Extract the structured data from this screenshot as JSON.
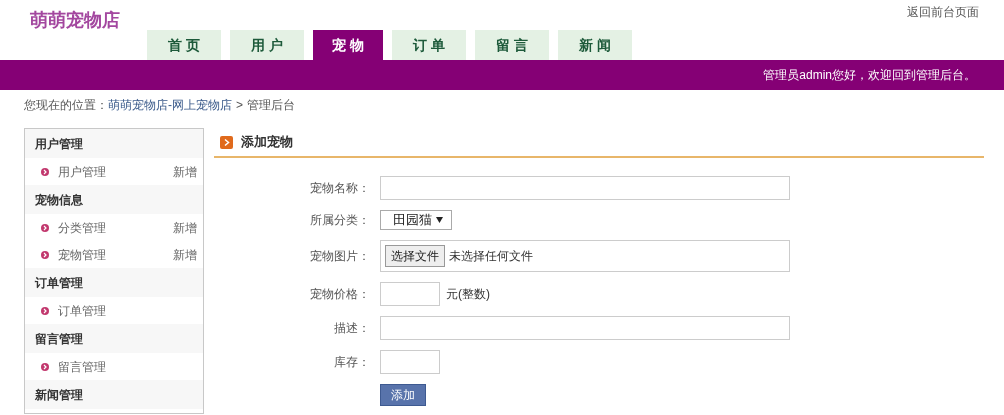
{
  "header": {
    "logo": "萌萌宠物店",
    "front_link": "返回前台页面",
    "welcome": "管理员admin您好，欢迎回到管理后台。"
  },
  "tabs": [
    {
      "label": "首 页",
      "selected": false
    },
    {
      "label": "用 户",
      "selected": false
    },
    {
      "label": "宠 物",
      "selected": true
    },
    {
      "label": "订 单",
      "selected": false
    },
    {
      "label": "留 言",
      "selected": false
    },
    {
      "label": "新 闻",
      "selected": false
    }
  ],
  "breadcrumb": {
    "prefix": "您现在的位置：",
    "link": "萌萌宠物店-网上宠物店",
    "separator": ">",
    "current": "管理后台"
  },
  "sidebar": [
    {
      "title": "用户管理",
      "items": [
        {
          "label": "用户管理",
          "action": "新增"
        }
      ]
    },
    {
      "title": "宠物信息",
      "items": [
        {
          "label": "分类管理",
          "action": "新增"
        },
        {
          "label": "宠物管理",
          "action": "新增"
        }
      ]
    },
    {
      "title": "订单管理",
      "items": [
        {
          "label": "订单管理"
        }
      ]
    },
    {
      "title": "留言管理",
      "items": [
        {
          "label": "留言管理"
        }
      ]
    },
    {
      "title": "新闻管理"
    }
  ],
  "panel": {
    "title": "添加宠物",
    "fields": [
      {
        "label": "宠物名称：",
        "kind": "long"
      },
      {
        "label": "所属分类：",
        "kind": "select",
        "value": "田园猫"
      },
      {
        "label": "宠物图片：",
        "kind": "file",
        "button": "选择文件",
        "status": "未选择任何文件"
      },
      {
        "label": "宠物价格：",
        "kind": "short",
        "suffix": "元(整数)"
      },
      {
        "label": "描述：",
        "kind": "long"
      },
      {
        "label": "库存：",
        "kind": "short"
      }
    ],
    "submit": "添加"
  }
}
